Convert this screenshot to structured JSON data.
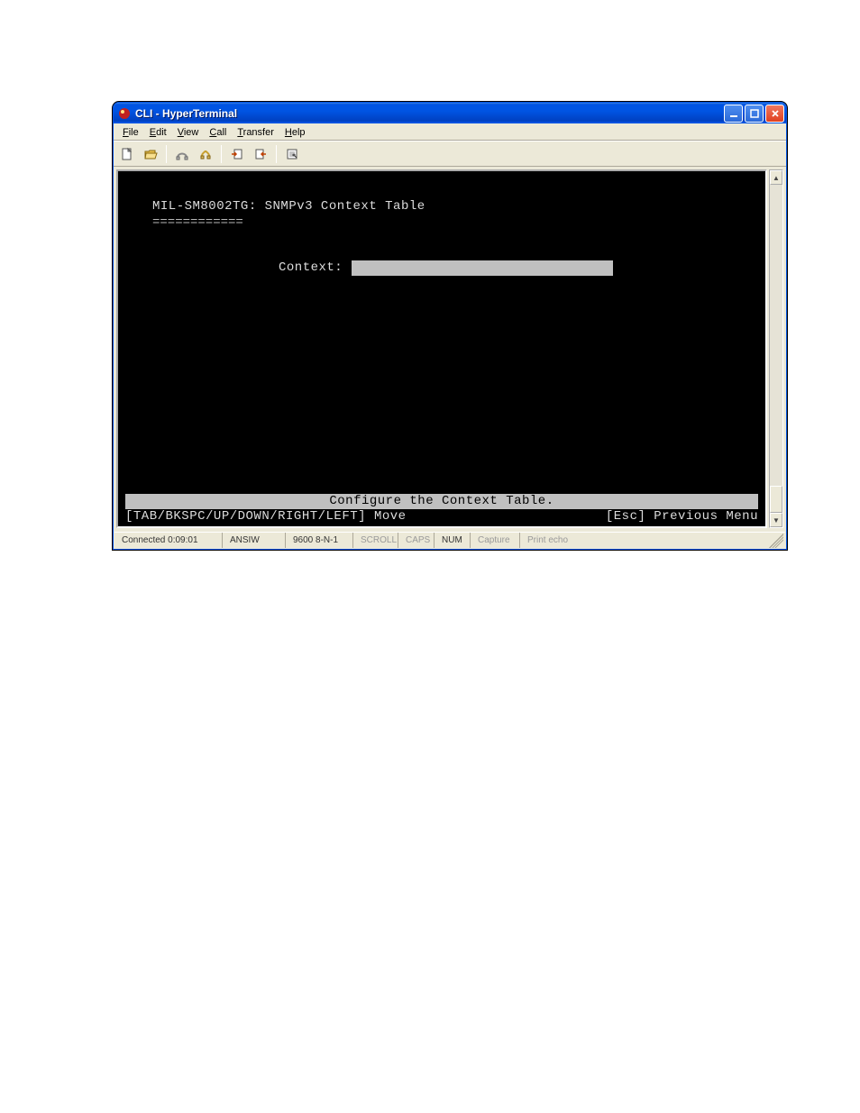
{
  "window": {
    "title": "CLI - HyperTerminal"
  },
  "menus": {
    "file": "File",
    "edit": "Edit",
    "view": "View",
    "call": "Call",
    "transfer": "Transfer",
    "help": "Help"
  },
  "terminal": {
    "device_header": "MIL-SM8002TG: SNMPv3 Context Table",
    "underline": "============",
    "context_label": "Context:",
    "context_value": "",
    "footer_highlight": "Configure the Context Table.",
    "footer_left": "[TAB/BKSPC/UP/DOWN/RIGHT/LEFT] Move",
    "footer_right": "[Esc] Previous Menu"
  },
  "status": {
    "connected": "Connected 0:09:01",
    "emulation": "ANSIW",
    "port": "9600 8-N-1",
    "scroll": "SCROLL",
    "caps": "CAPS",
    "num": "NUM",
    "capture": "Capture",
    "printecho": "Print echo"
  }
}
